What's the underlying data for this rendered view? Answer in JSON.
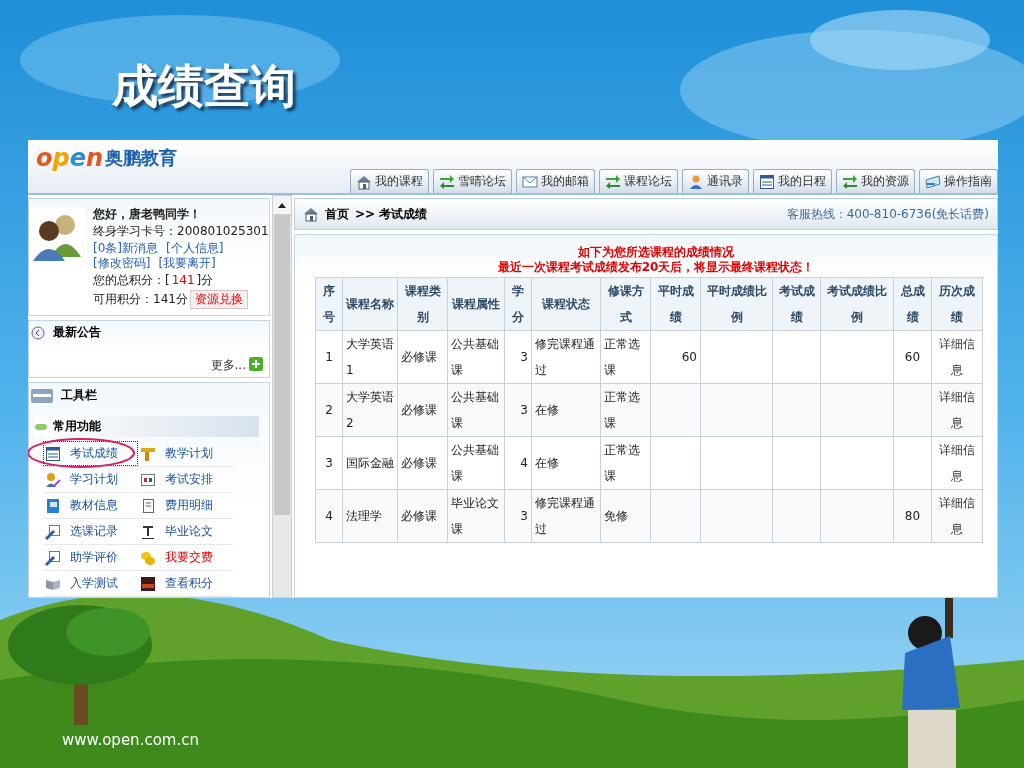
{
  "slide_title": "成绩查询",
  "logo": {
    "mark": "open",
    "name": "奥鹏教育"
  },
  "nav_tabs": [
    {
      "label": "我的课程",
      "kind": "home"
    },
    {
      "label": "雪晴论坛",
      "kind": "arrows"
    },
    {
      "label": "我的邮箱",
      "kind": "mail"
    },
    {
      "label": "课程论坛",
      "kind": "arrows"
    },
    {
      "label": "通讯录",
      "kind": "person"
    },
    {
      "label": "我的日程",
      "kind": "calendar"
    },
    {
      "label": "我的资源",
      "kind": "arrows"
    },
    {
      "label": "操作指南",
      "kind": "card"
    }
  ],
  "user": {
    "greeting": "您好，唐老鸭同学！",
    "card_number": "终身学习卡号：200801025301",
    "links": [
      "[0条]新消息",
      "[个人信息]",
      "[修改密码]",
      "[我要离开]"
    ],
    "total_prefix": "您的总积分：[",
    "total_value": "141",
    "total_suffix": "]分",
    "available": "可用积分：141分",
    "redeem_button": "资源兑换"
  },
  "announcements": {
    "title": "最新公告",
    "more": "更多..."
  },
  "toolbar": {
    "title": "工具栏",
    "section": "常用功能",
    "items": [
      {
        "label": "考试成绩",
        "kind": "calendar",
        "selected": true,
        "emphasized": false
      },
      {
        "label": "教学计划",
        "kind": "ruler",
        "selected": false,
        "emphasized": false
      },
      {
        "label": "学习计划",
        "kind": "learner",
        "selected": false,
        "emphasized": false
      },
      {
        "label": "考试安排",
        "kind": "letters",
        "selected": false,
        "emphasized": false
      },
      {
        "label": "教材信息",
        "kind": "book",
        "selected": false,
        "emphasized": false
      },
      {
        "label": "费用明细",
        "kind": "scroll",
        "selected": false,
        "emphasized": false
      },
      {
        "label": "选课记录",
        "kind": "note",
        "selected": false,
        "emphasized": false
      },
      {
        "label": "毕业论文",
        "kind": "type",
        "selected": false,
        "emphasized": false
      },
      {
        "label": "助学评价",
        "kind": "note",
        "selected": false,
        "emphasized": false
      },
      {
        "label": "我要交费",
        "kind": "coins",
        "selected": false,
        "emphasized": true
      },
      {
        "label": "入学测试",
        "kind": "openbook",
        "selected": false,
        "emphasized": false
      },
      {
        "label": "查看积分",
        "kind": "badge",
        "selected": false,
        "emphasized": false
      }
    ]
  },
  "breadcrumb": {
    "home": "首页",
    "current": ">> 考试成绩",
    "hotline": "客服热线：400-810-6736(免长话费)"
  },
  "notice": [
    "如下为您所选课程的成绩情况",
    "最近一次课程考试成绩发布20天后，将显示最终课程状态！"
  ],
  "table": {
    "columns": [
      "序号",
      "课程名称",
      "课程类别",
      "课程属性",
      "学分",
      "课程状态",
      "修课方式",
      "平时成绩",
      "平时成绩比例",
      "考试成绩",
      "考试成绩比例",
      "总成绩",
      "历次成绩"
    ],
    "rows": [
      [
        "1",
        "大学英语1",
        "必修课",
        "公共基础课",
        "3",
        "修完课程通过",
        "正常选课",
        "60",
        null,
        null,
        null,
        "60",
        "详细信息"
      ],
      [
        "2",
        "大学英语2",
        "必修课",
        "公共基础课",
        "3",
        "在修",
        "正常选课",
        null,
        null,
        null,
        null,
        null,
        "详细信息"
      ],
      [
        "3",
        "国际金融",
        "必修课",
        "公共基础课",
        "4",
        "在修",
        "正常选课",
        null,
        null,
        null,
        null,
        null,
        "详细信息"
      ],
      [
        "4",
        "法理学",
        "必修课",
        "毕业论文课",
        "3",
        "修完课程通过",
        "免修",
        null,
        null,
        null,
        null,
        "80",
        "详细信息"
      ]
    ]
  },
  "footer_url": "www.open.com.cn"
}
